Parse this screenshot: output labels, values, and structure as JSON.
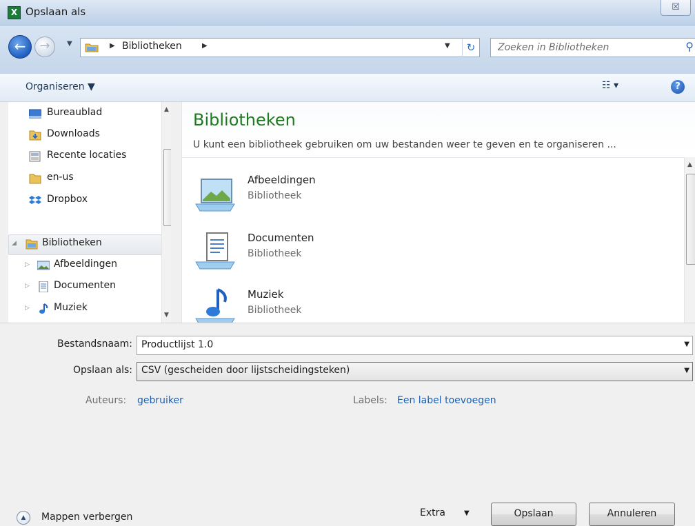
{
  "window": {
    "title": "Opslaan als",
    "close_glyph": "☒"
  },
  "address": {
    "path": "Bibliotheken",
    "separator": "▶"
  },
  "search": {
    "placeholder": "Zoeken in Bibliotheken"
  },
  "toolbar": {
    "organize_label": "Organiseren ▼",
    "view_label": "☷ ▾",
    "help_label": "?"
  },
  "nav": {
    "items": [
      {
        "label": "Bureaublad",
        "icon": "desktop-icon"
      },
      {
        "label": "Downloads",
        "icon": "downloads-folder-icon"
      },
      {
        "label": "Recente locaties",
        "icon": "recent-places-icon"
      },
      {
        "label": "en-us",
        "icon": "folder-icon"
      },
      {
        "label": "Dropbox",
        "icon": "dropbox-icon"
      },
      {
        "label": "Bibliotheken",
        "icon": "libraries-icon",
        "selected": true
      },
      {
        "label": "Afbeeldingen",
        "icon": "pictures-icon"
      },
      {
        "label": "Documenten",
        "icon": "documents-icon"
      },
      {
        "label": "Muziek",
        "icon": "music-icon"
      }
    ]
  },
  "content": {
    "title": "Bibliotheken",
    "description": "U kunt een bibliotheek gebruiken om uw bestanden weer te geven en te organiseren ...",
    "libraries": [
      {
        "name": "Afbeeldingen",
        "type": "Bibliotheek",
        "icon": "pictures-library-icon"
      },
      {
        "name": "Documenten",
        "type": "Bibliotheek",
        "icon": "documents-library-icon"
      },
      {
        "name": "Muziek",
        "type": "Bibliotheek",
        "icon": "music-library-icon"
      }
    ]
  },
  "form": {
    "filename_label": "Bestandsnaam:",
    "filename_value": "Productlijst 1.0",
    "filetype_label": "Opslaan als:",
    "filetype_value": "CSV (gescheiden door lijstscheidingsteken)",
    "authors_label": "Auteurs:",
    "authors_value": "gebruiker",
    "tags_label": "Labels:",
    "tags_value": "Een label toevoegen"
  },
  "footer": {
    "hide_folders_label": "Mappen verbergen",
    "extra_label": "Extra",
    "save_label": "Opslaan",
    "cancel_label": "Annuleren"
  },
  "colors": {
    "accent_title": "#1e7b1e",
    "link": "#1a5fb4"
  }
}
